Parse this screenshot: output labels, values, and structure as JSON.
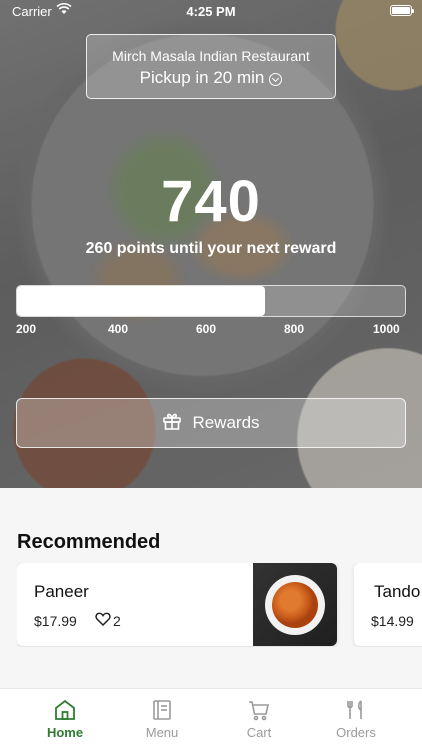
{
  "status_bar": {
    "carrier": "Carrier",
    "time": "4:25 PM"
  },
  "store": {
    "name": "Mirch Masala Indian Restaurant",
    "pickup": "Pickup in 20 min"
  },
  "rewards": {
    "points": "740",
    "subtitle": "260 points until your next reward",
    "progress_fraction": 0.64,
    "scale": [
      "200",
      "400",
      "600",
      "800",
      "1000"
    ],
    "button_label": "Rewards"
  },
  "recommended": {
    "title": "Recommended",
    "items": [
      {
        "name": "Paneer",
        "price": "$17.99",
        "likes": "2"
      },
      {
        "name": "Tando",
        "price": "$14.99"
      }
    ]
  },
  "tabs": [
    {
      "label": "Home",
      "icon": "home-icon",
      "active": true
    },
    {
      "label": "Menu",
      "icon": "menu-icon",
      "active": false
    },
    {
      "label": "Cart",
      "icon": "cart-icon",
      "active": false
    },
    {
      "label": "Orders",
      "icon": "orders-icon",
      "active": false
    }
  ],
  "colors": {
    "accent": "#2e7d32",
    "inactive": "#9a9a9a"
  }
}
